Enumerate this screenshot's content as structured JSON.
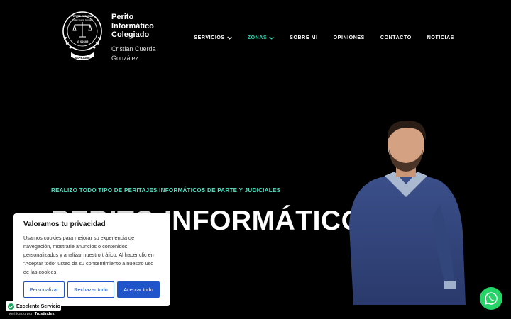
{
  "brand": {
    "title_lines": [
      "Perito",
      "Informático",
      "Colegiado"
    ],
    "name_lines": [
      "Cristian Cuerda",
      "González"
    ],
    "seal_top_text": "PERITO JUDICIAL",
    "seal_ring_text": "Cristian Cuerda González",
    "seal_number": "Nº 02605",
    "seal_bottom_text": "ASPEJURE"
  },
  "nav": {
    "items": [
      {
        "label": "SERVICIOS",
        "has_dropdown": true,
        "active": false
      },
      {
        "label": "ZONAS",
        "has_dropdown": true,
        "active": true
      },
      {
        "label": "SOBRE MÍ",
        "has_dropdown": false,
        "active": false
      },
      {
        "label": "OPINIONES",
        "has_dropdown": false,
        "active": false
      },
      {
        "label": "CONTACTO",
        "has_dropdown": false,
        "active": false
      },
      {
        "label": "NOTICIAS",
        "has_dropdown": false,
        "active": false
      }
    ],
    "active_color": "#2fd3b0"
  },
  "hero": {
    "subtitle": "REALIZO TODO TIPO DE PERITAJES INFORMÁTICOS DE PARTE Y JUDICIALES",
    "title": "PERITO INFORMÁTICO",
    "accent_color": "#52e0c4"
  },
  "cookie": {
    "title": "Valoramos tu privacidad",
    "text": "Usamos cookies para mejorar su experiencia de navegación, mostrarle anuncios o contenidos personalizados y analizar nuestro tráfico. Al hacer clic en “Aceptar todo” usted da su consentimiento a nuestro uso de las cookies.",
    "customize_label": "Personalizar",
    "reject_label": "Rechazar todo",
    "accept_label": "Aceptar todo",
    "button_color": "#1f55c8"
  },
  "trust": {
    "label": "Excelente Servicio",
    "verified_prefix": "Verificado por:",
    "verified_brand": "Trustindex"
  },
  "whatsapp": {
    "icon": "whatsapp-icon",
    "color": "#25d366"
  }
}
